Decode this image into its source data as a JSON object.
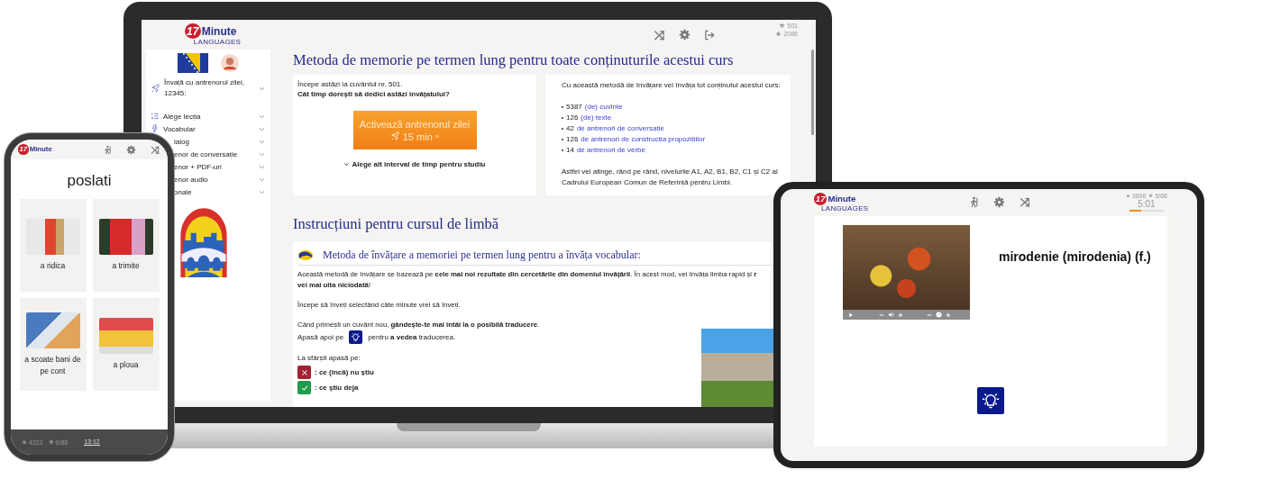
{
  "laptop": {
    "logo": {
      "number": "17",
      "word": "Minute",
      "tagline": "LANGUAGES"
    },
    "toolbar_stats": [
      {
        "kind": "cap",
        "value": "501"
      },
      {
        "kind": "star",
        "value": "2086"
      }
    ],
    "sidebar": {
      "trainer": "Învață cu antrenorul zilei, 12345:",
      "items": [
        {
          "kind": "full",
          "label": "Alege lecția"
        },
        {
          "kind": "full",
          "label": "Vocabular"
        },
        {
          "kind": "covered",
          "label": "ialog"
        },
        {
          "kind": "covered",
          "label": "enor de conversație"
        },
        {
          "kind": "covered",
          "label": "enor + PDF-uri"
        },
        {
          "kind": "covered",
          "label": "enor audio"
        },
        {
          "kind": "covered",
          "label": "onale"
        }
      ]
    },
    "heading": "Metoda de memorie pe termen lung pentru toate conținuturile acestui curs",
    "start_card": {
      "intro": "Începe astăzi la cuvântul nr. 501.",
      "question": "Cât timp dorești să dedici astăzi învățatului?",
      "button_label": "Activează antrenorul zilei",
      "button_duration": "15 min",
      "button_arrow": "»",
      "other_interval": "Alege alt interval de timp pentru studiu"
    },
    "content_card": {
      "intro": "Cu această metodă de învățare vei învăța tot conținutul acestui curs:",
      "items": [
        {
          "count": "5387",
          "link": "(de) cuvinte"
        },
        {
          "count": "126",
          "link": "(de) texte"
        },
        {
          "count": "42",
          "link": "de antrenori de conversație"
        },
        {
          "count": "126",
          "link": "de antrenori de construcția propozițiilor"
        },
        {
          "count": "14",
          "link": "de antrenori de verbe"
        }
      ],
      "outro": "Astfel vei atinge, rând pe rând, nivelurile A1, A2, B1, B2, C1 și C2 al Cadrului European Comun de Referință pentru Limbi."
    },
    "instructions": {
      "heading": "Instrucțiuni pentru cursul de limbă",
      "subheading": "Metoda de învățare a memoriei pe termen lung pentru a învăța vocabular:",
      "paragraph_1": "Această metodă de învățare se bazează pe **cele mai noi rezultate din cercetările din domeniul învățării**. În acest mod, vei învăța limba rapid și **r**\n**vei mai uita niciodată**!",
      "paragraph_2": "Începe să înveți selectând câte minute vrei să înveți.",
      "paragraph_3": "Când primești un cuvânt nou, **gândește-te mai întâi la o posibilă traducere**.",
      "press_before": "Apasă apoi pe",
      "press_after": "pentru **a vedea** traducerea.",
      "end_label": "La sfârșit apasă pe:",
      "legend": [
        {
          "kind": "wrong",
          "label": ": ce (încă) nu știu"
        },
        {
          "kind": "right",
          "label": ": ce știu deja"
        }
      ]
    }
  },
  "phone": {
    "logo": {
      "number": "17",
      "word": "Minute"
    },
    "word": "poslati",
    "cards": [
      {
        "kind": "delivery",
        "label": "a ridica"
      },
      {
        "kind": "mailbox",
        "label": "a trimite"
      },
      {
        "kind": "atm",
        "label": "a scoate bani de pe cont"
      },
      {
        "kind": "rain",
        "label": "a ploua"
      }
    ],
    "stats": [
      {
        "kind": "star",
        "value": "4222"
      },
      {
        "kind": "cap",
        "value": "0/88"
      }
    ],
    "time": "13:12"
  },
  "tablet": {
    "logo": {
      "number": "17",
      "word": "Minute",
      "tagline": "LANGUAGES"
    },
    "stats": [
      {
        "kind": "star",
        "value": "3606"
      },
      {
        "kind": "cap",
        "value": "5/68"
      }
    ],
    "timer": "5:01",
    "level": 0.35,
    "word": "mirodenie (mirodenia) (f.)"
  }
}
